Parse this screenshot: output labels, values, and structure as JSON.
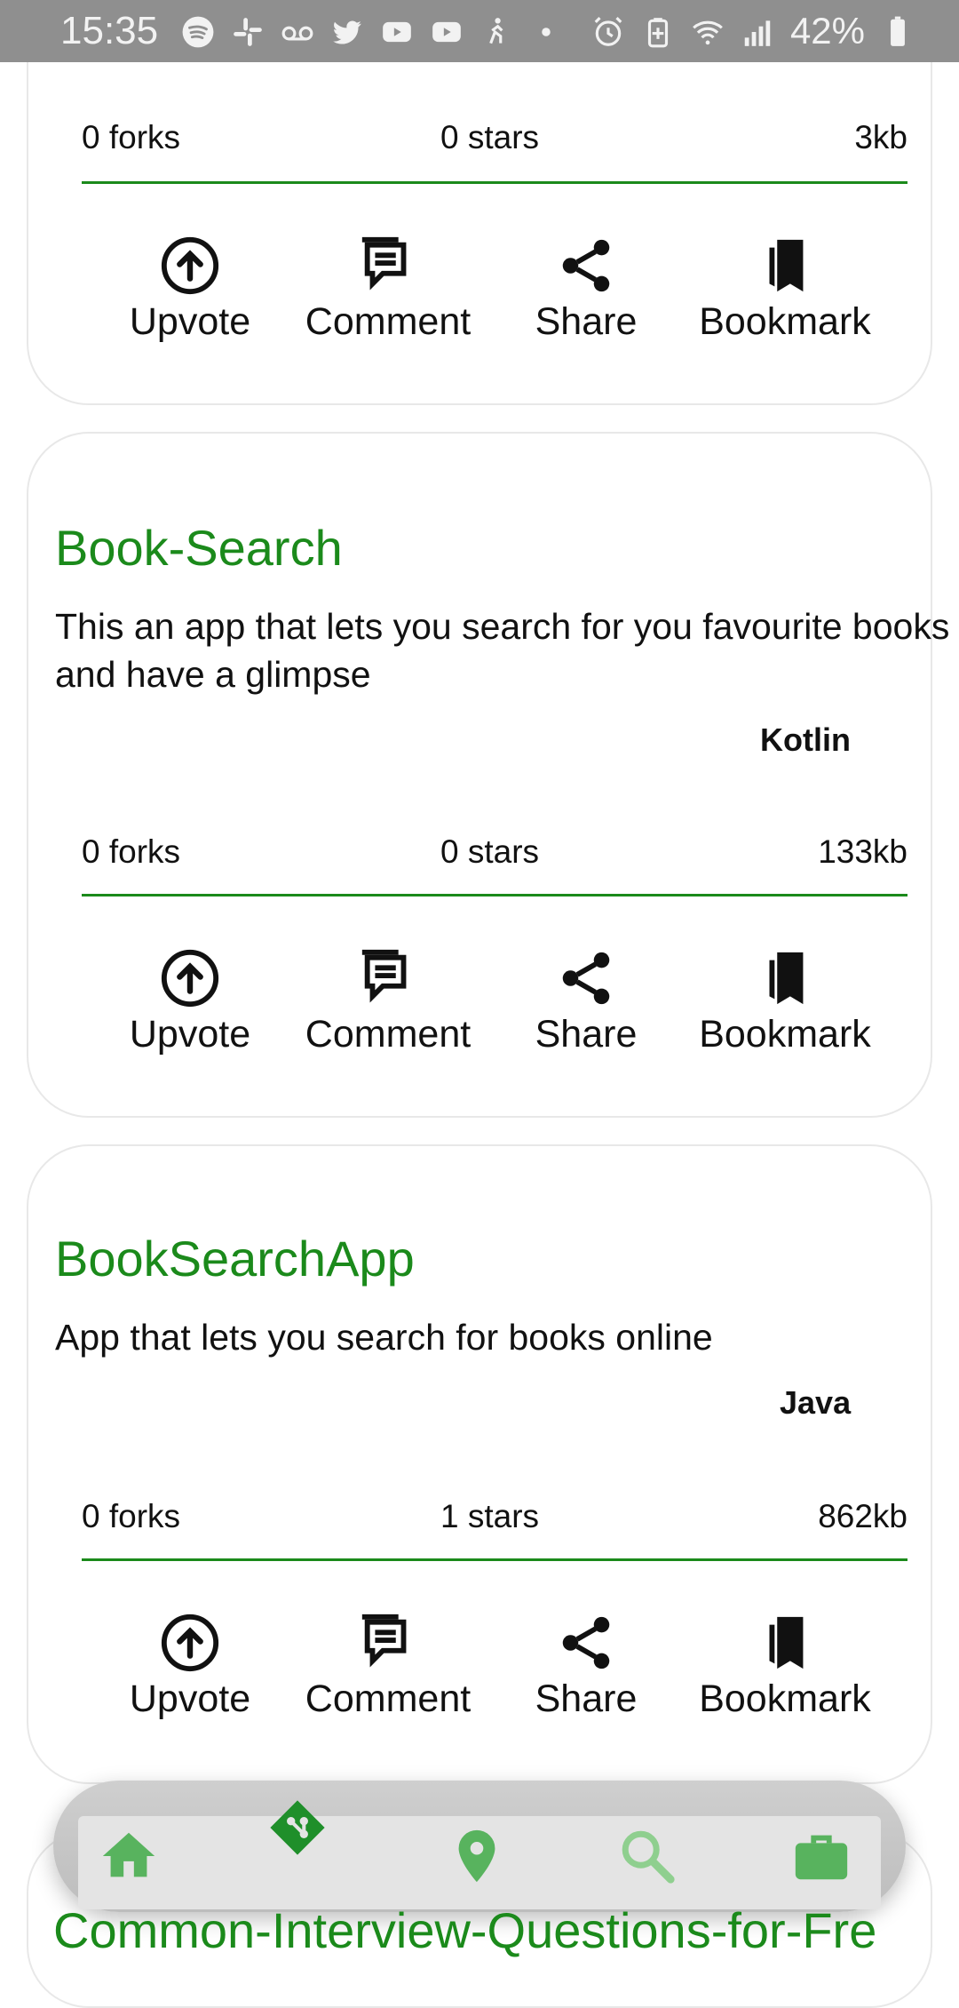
{
  "status_bar": {
    "time": "15:35",
    "battery": "42%",
    "icons_left": [
      "spotify-icon",
      "slack-icon",
      "voicemail-icon",
      "twitter-icon",
      "youtube-icon",
      "youtube-icon",
      "accessibility-icon",
      "dot-icon"
    ],
    "icons_right": [
      "alarm-icon",
      "battery-saver-icon",
      "wifi-icon",
      "signal-icon",
      "battery-icon"
    ]
  },
  "cards": [
    {
      "forks": "0 forks",
      "stars": "0 stars",
      "size": "3kb",
      "actions": {
        "upvote": "Upvote",
        "comment": "Comment",
        "share": "Share",
        "bookmark": "Bookmark"
      }
    },
    {
      "title": "Book-Search",
      "description": "This an app that lets you search for you favourite books and have a glimpse",
      "language": "Kotlin",
      "forks": "0 forks",
      "stars": "0 stars",
      "size": "133kb",
      "actions": {
        "upvote": "Upvote",
        "comment": "Comment",
        "share": "Share",
        "bookmark": "Bookmark"
      }
    },
    {
      "title": "BookSearchApp",
      "description": "App that lets you search for books online",
      "language": "Java",
      "forks": "0 forks",
      "stars": "1 stars",
      "size": "862kb",
      "actions": {
        "upvote": "Upvote",
        "comment": "Comment",
        "share": "Share",
        "bookmark": "Bookmark"
      }
    },
    {
      "title": "Common-Interview-Questions-for-Fre"
    }
  ],
  "bottom_nav": {
    "items": [
      "home-icon",
      "git-icon",
      "location-icon",
      "search-icon",
      "briefcase-icon"
    ],
    "active_color": "#2e9b3a",
    "inactive_color": "#58b35e"
  },
  "colors": {
    "accent": "#1b8a1b",
    "status_bar_bg": "#8f8f8f"
  }
}
